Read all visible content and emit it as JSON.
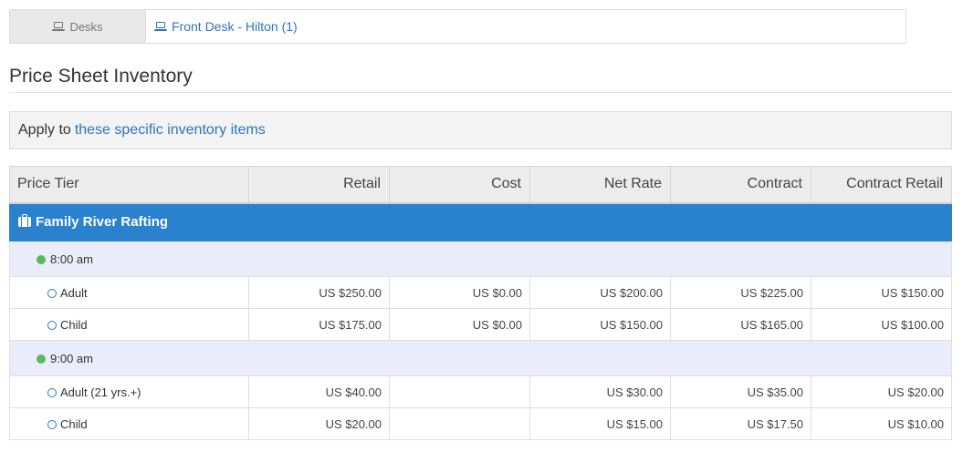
{
  "desks": {
    "label": "Desks",
    "link_text": "Front Desk - Hilton (1)",
    "label_icon": "laptop-icon",
    "link_icon": "laptop-icon"
  },
  "page_title": "Price Sheet Inventory",
  "apply": {
    "prefix": "Apply to",
    "link_text": "these specific inventory items"
  },
  "table": {
    "headers": [
      "Price Tier",
      "Retail",
      "Cost",
      "Net Rate",
      "Contract",
      "Contract Retail"
    ],
    "product": {
      "name": "Family River Rafting",
      "icon": "briefcase-icon",
      "color": "#2a81cd"
    },
    "times": [
      {
        "time": "8:00 am",
        "rows": [
          {
            "tier": "Adult",
            "retail": "US $250.00",
            "cost": "US $0.00",
            "net_rate": "US $200.00",
            "contract": "US $225.00",
            "contract_retail": "US $150.00"
          },
          {
            "tier": "Child",
            "retail": "US $175.00",
            "cost": "US $0.00",
            "net_rate": "US $150.00",
            "contract": "US $165.00",
            "contract_retail": "US $100.00"
          }
        ]
      },
      {
        "time": "9:00 am",
        "rows": [
          {
            "tier": "Adult (21 yrs.+)",
            "retail": "US $40.00",
            "cost": "",
            "net_rate": "US $30.00",
            "contract": "US $35.00",
            "contract_retail": "US $20.00"
          },
          {
            "tier": "Child",
            "retail": "US $20.00",
            "cost": "",
            "net_rate": "US $15.00",
            "contract": "US $17.50",
            "contract_retail": "US $10.00"
          }
        ]
      }
    ]
  },
  "colors": {
    "link": "#2a76c0",
    "time_dot": "#5cb85c",
    "time_row_bg": "#eaecf9",
    "header_bg": "#ececec"
  }
}
